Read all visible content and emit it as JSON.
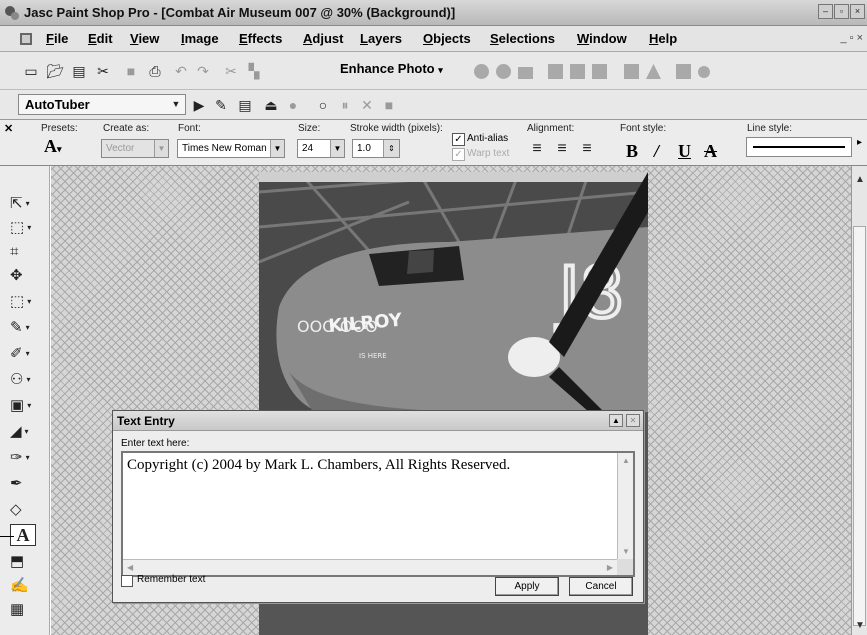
{
  "window": {
    "title": "Jasc Paint Shop Pro - [Combat Air Museum 007 @  30% (Background)]",
    "controls": [
      "–",
      "▫",
      "×"
    ]
  },
  "menubar": {
    "items": [
      "File",
      "Edit",
      "View",
      "Image",
      "Effects",
      "Adjust",
      "Layers",
      "Objects",
      "Selections",
      "Window",
      "Help"
    ],
    "doc_controls": "_ ▫ ×"
  },
  "toolbar": {
    "enhance_photo_label": "Enhance Photo",
    "enhance_arrow": "▾"
  },
  "scriptbar": {
    "script_name": "AutoTuber"
  },
  "text_options": {
    "presets_label": "Presets:",
    "create_as_label": "Create as:",
    "create_as_value": "Vector",
    "font_label": "Font:",
    "font_value": "Times New Roman",
    "size_label": "Size:",
    "size_value": "24",
    "stroke_label": "Stroke width (pixels):",
    "stroke_value": "1.0",
    "anti_alias_label": "Anti-alias",
    "warp_text_label": "Warp text",
    "alignment_label": "Alignment:",
    "font_style_label": "Font style:",
    "line_style_label": "Line style:",
    "font_style_buttons": [
      "B",
      "/",
      "U",
      "A"
    ]
  },
  "text_entry_dialog": {
    "title": "Text Entry",
    "prompt": "Enter text here:",
    "text": "Copyright (c) 2004 by Mark L. Chambers, All Rights Reserved.",
    "remember_text_label": "Remember text",
    "apply_label": "Apply",
    "cancel_label": "Cancel"
  },
  "photo": {
    "nose_art_text": "KILROY",
    "nose_art_subtext": "IS HERE",
    "tail_code": "J8",
    "nose_art_loops": "OOO  OOO"
  },
  "icons": {
    "pick": "arrow-pointer-icon",
    "selection": "selection-icon",
    "crop": "crop-icon",
    "move": "move-icon",
    "marquee": "marquee-icon",
    "paintbrush": "paintbrush-icon",
    "airbrush": "airbrush-icon",
    "clone": "clone-icon",
    "replacer": "replacer-icon",
    "dodge": "dodge-icon",
    "smudge": "smudge-icon",
    "eraser": "eraser-icon",
    "fill": "fill-icon",
    "text": "text-tool-icon",
    "shape": "shape-icon",
    "pen": "pen-icon",
    "picture-tube": "picture-tube-icon"
  }
}
